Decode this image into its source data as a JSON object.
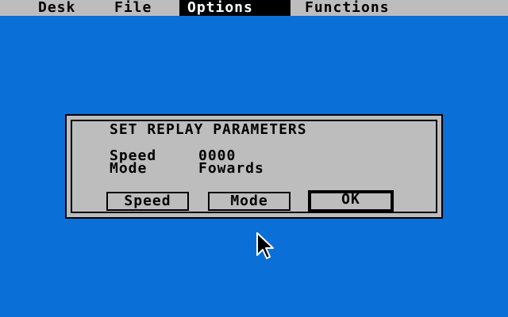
{
  "menubar": {
    "items": [
      {
        "label": "Desk",
        "active": false
      },
      {
        "label": "File",
        "active": false
      },
      {
        "label": "Options",
        "active": true
      },
      {
        "label": "Functions",
        "active": false
      }
    ]
  },
  "dialog": {
    "title": "SET REPLAY PARAMETERS",
    "speed_label": "Speed",
    "speed_value": "0000",
    "mode_label": "Mode",
    "mode_value": "Fowards",
    "buttons": {
      "speed": "Speed",
      "mode": "Mode",
      "ok": "OK"
    }
  },
  "colors": {
    "desktop": "#0a6fd6",
    "dialog_bg": "#bdbdbd",
    "menubar_bg": "#bdbdbd",
    "text": "#000000"
  }
}
